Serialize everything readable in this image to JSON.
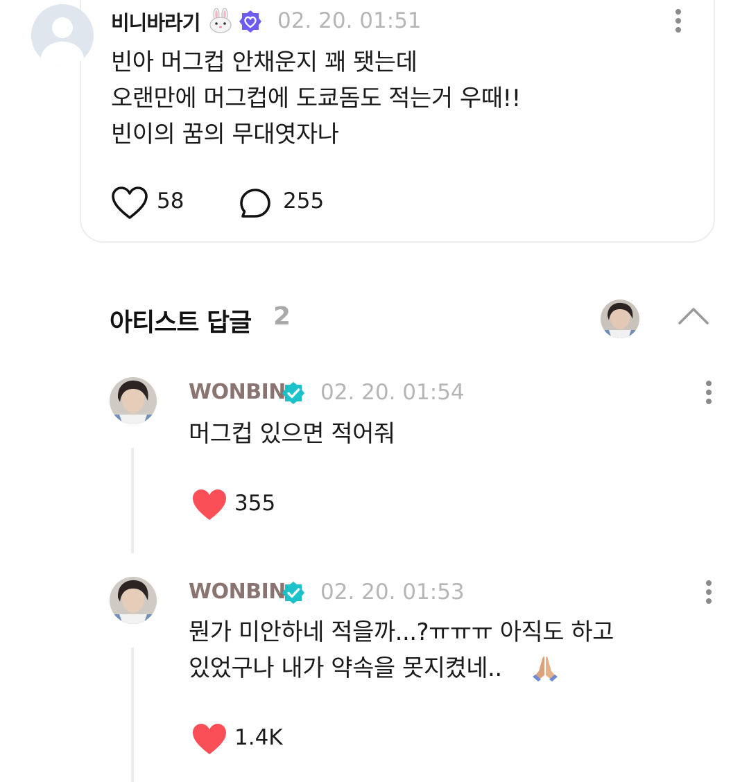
{
  "post": {
    "username": "비니바라기",
    "time": "02. 20. 01:51",
    "body": "빈아 머그컵 안채운지 꽤 됏는데\n오랜만에 머그컵에 도쿄돔도 적는거 우때!!\n빈이의 꿈의 무대엿자나",
    "likes": "58",
    "comments": "255",
    "icons": [
      "person-placeholder-icon",
      "bunny-emoji-icon",
      "verified-badge-icon",
      "more-vertical-icon",
      "heart-outline-icon",
      "comment-bubble-icon"
    ]
  },
  "artist_replies": {
    "title": "아티스트 답글",
    "count": "2",
    "icons": [
      "artist-avatar",
      "chevron-up-icon"
    ]
  },
  "replies": [
    {
      "name": "WONBIN",
      "time": "02. 20. 01:54",
      "text": "머그컵 있으면 적어줘",
      "likes": "355"
    },
    {
      "name": "WONBIN",
      "time": "02. 20. 01:53",
      "text": "뭔가 미안하네 적을까...?ㅠㅠㅠ 아직도 하고\n있었구나 내가 약속을 못지켰네..",
      "emoji": "folded-hands-emoji",
      "likes": "1.4K"
    }
  ],
  "colors": {
    "heart_filled": "#fb4f57",
    "verified_teal": "#1cc1c9",
    "verified_purple": "#6d5bf5",
    "artist_name": "#8a7470",
    "muted": "#b5b5b5"
  }
}
